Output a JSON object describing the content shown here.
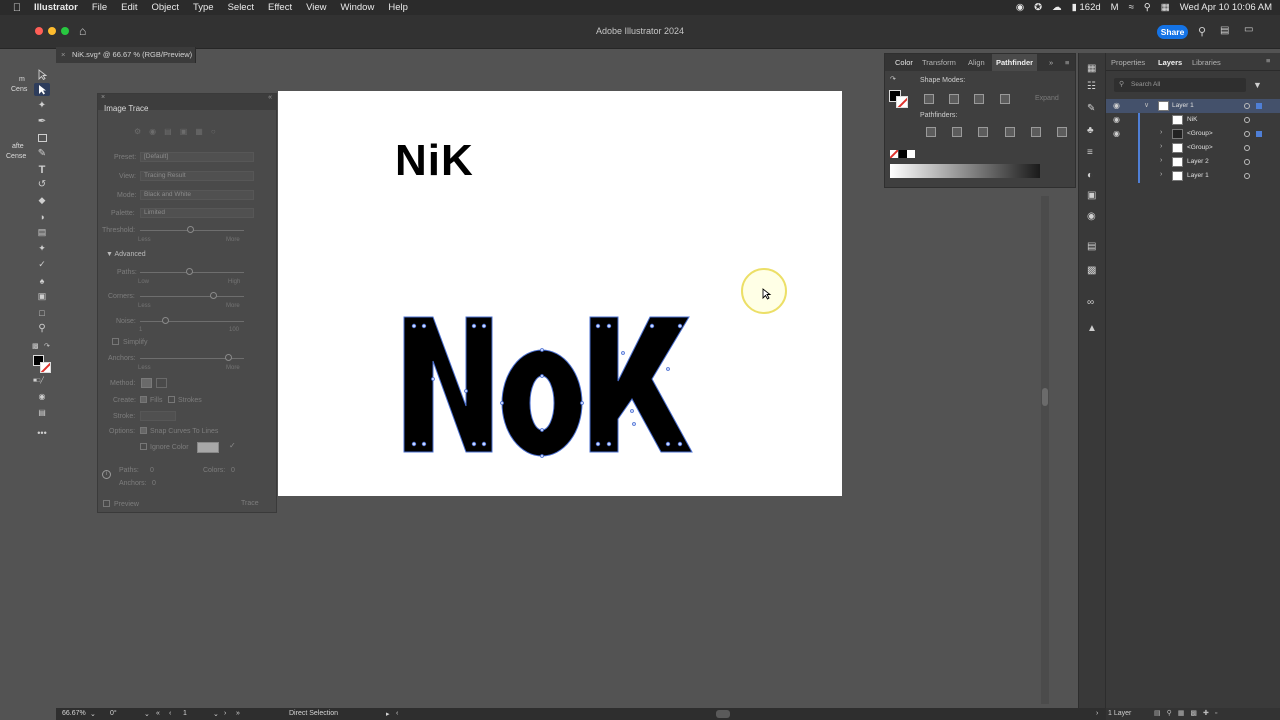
{
  "menubar": {
    "app_name": "Illustrator",
    "items": [
      "File",
      "Edit",
      "Object",
      "Type",
      "Select",
      "Effect",
      "View",
      "Window",
      "Help"
    ],
    "battery_label": "162d",
    "datetime": "Wed Apr 10  10:06 AM"
  },
  "appbar": {
    "title": "Adobe Illustrator 2024",
    "share_label": "Share"
  },
  "document_tab": {
    "label": "NiK.svg* @ 66.67 % (RGB/Preview)"
  },
  "left_fragments": {
    "line1": "m",
    "line2": "Cens",
    "line3": "afte",
    "line4": "Cense"
  },
  "artboard": {
    "small_text": "NiK",
    "letters": [
      "N",
      "o",
      "K"
    ]
  },
  "image_trace": {
    "title": "Image Trace",
    "preset_label": "Preset:",
    "preset_value": "[Default]",
    "view_label": "View:",
    "view_value": "Tracing Result",
    "mode_label": "Mode:",
    "mode_value": "Black and White",
    "palette_label": "Palette:",
    "palette_value": "Limited",
    "threshold_label": "Threshold:",
    "less": "Less",
    "more": "More",
    "advanced_label": "Advanced",
    "paths_label": "Paths:",
    "low": "Low",
    "high": "High",
    "corners_label": "Corners:",
    "noise_label": "Noise:",
    "noise_min": "1",
    "noise_max": "100",
    "simplify_label": "Simplify",
    "anchors_label": "Anchors:",
    "method_label": "Method:",
    "create_label": "Create:",
    "fills_label": "Fills",
    "strokes_label": "Strokes",
    "stroke_label": "Stroke:",
    "options_label": "Options:",
    "snap_label": "Snap Curves To Lines",
    "ignore_label": "Ignore Color",
    "paths_stat": "Paths:",
    "paths_stat_val": "0",
    "colors_stat": "Colors:",
    "colors_stat_val": "0",
    "anchors_stat": "Anchors:",
    "anchors_stat_val": "0",
    "preview_label": "Preview",
    "trace_label": "Trace"
  },
  "pathfinder": {
    "tabs": [
      "Color",
      "Transform",
      "Align",
      "Pathfinder"
    ],
    "shape_modes_label": "Shape Modes:",
    "expand_label": "Expand",
    "pathfinders_label": "Pathfinders:"
  },
  "layers_panel": {
    "tabs": [
      "Properties",
      "Layers",
      "Libraries"
    ],
    "search_placeholder": "Search All",
    "rows": [
      {
        "name": "Layer 1"
      },
      {
        "name": "NiK"
      },
      {
        "name": "<Group>"
      },
      {
        "name": "<Group>"
      },
      {
        "name": "Layer 2"
      },
      {
        "name": "Layer 1"
      }
    ],
    "footer_count": "1 Layer"
  },
  "statusbar": {
    "zoom": "66.67%",
    "rotation": "0°",
    "artboard_num": "1",
    "tool": "Direct Selection"
  },
  "colors": {
    "accent": "#1473e6",
    "selection": "#4f7fd6"
  }
}
